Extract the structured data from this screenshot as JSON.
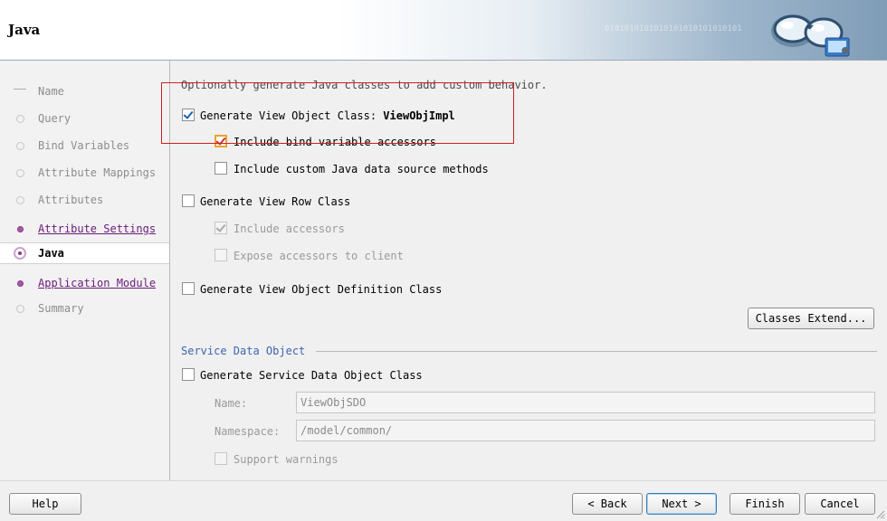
{
  "header": {
    "title": "Java",
    "watermark": "0101010101010101010101010101"
  },
  "nav": {
    "items": [
      {
        "label": "Name",
        "state": "pending"
      },
      {
        "label": "Query",
        "state": "pending"
      },
      {
        "label": "Bind Variables",
        "state": "pending"
      },
      {
        "label": "Attribute Mappings",
        "state": "pending"
      },
      {
        "label": "Attributes",
        "state": "pending"
      },
      {
        "label": "Attribute Settings",
        "state": "done"
      },
      {
        "label": "Java",
        "state": "current"
      },
      {
        "label": "Application Module",
        "state": "done"
      },
      {
        "label": "Summary",
        "state": "pending"
      }
    ]
  },
  "content": {
    "intro": "Optionally generate Java classes to add custom behavior.",
    "gen_vo_class": {
      "label": "Generate View Object Class: ",
      "value": "ViewObjImpl",
      "checked": true
    },
    "include_bind_accessors": {
      "label": "Include bind variable accessors",
      "checked": true
    },
    "include_custom_java": {
      "label": "Include custom Java data source methods",
      "checked": false
    },
    "gen_view_row_class": {
      "label": "Generate View Row Class",
      "checked": false
    },
    "include_accessors": {
      "label": "Include accessors",
      "checked": true,
      "disabled": true
    },
    "expose_accessors": {
      "label": "Expose accessors to client",
      "checked": false,
      "disabled": true
    },
    "gen_vo_def_class": {
      "label": "Generate View Object Definition Class",
      "checked": false
    },
    "classes_extend_button": "Classes Extend..."
  },
  "sdo": {
    "section_title": "Service Data Object",
    "gen_sdo_class": {
      "label": "Generate Service Data Object Class",
      "checked": false
    },
    "name_label": "Name:",
    "name_value": "ViewObjSDO",
    "namespace_label": "Namespace:",
    "namespace_value": "/model/common/",
    "support_warnings": {
      "label": "Support warnings",
      "checked": false,
      "disabled": true
    }
  },
  "footer": {
    "help": "Help",
    "back": "< Back",
    "next": "Next >",
    "finish": "Finish",
    "cancel": "Cancel"
  },
  "colors": {
    "accent_purple": "#8a3a8a",
    "section_blue": "#3a66b0",
    "highlight_red": "#cf2020"
  }
}
